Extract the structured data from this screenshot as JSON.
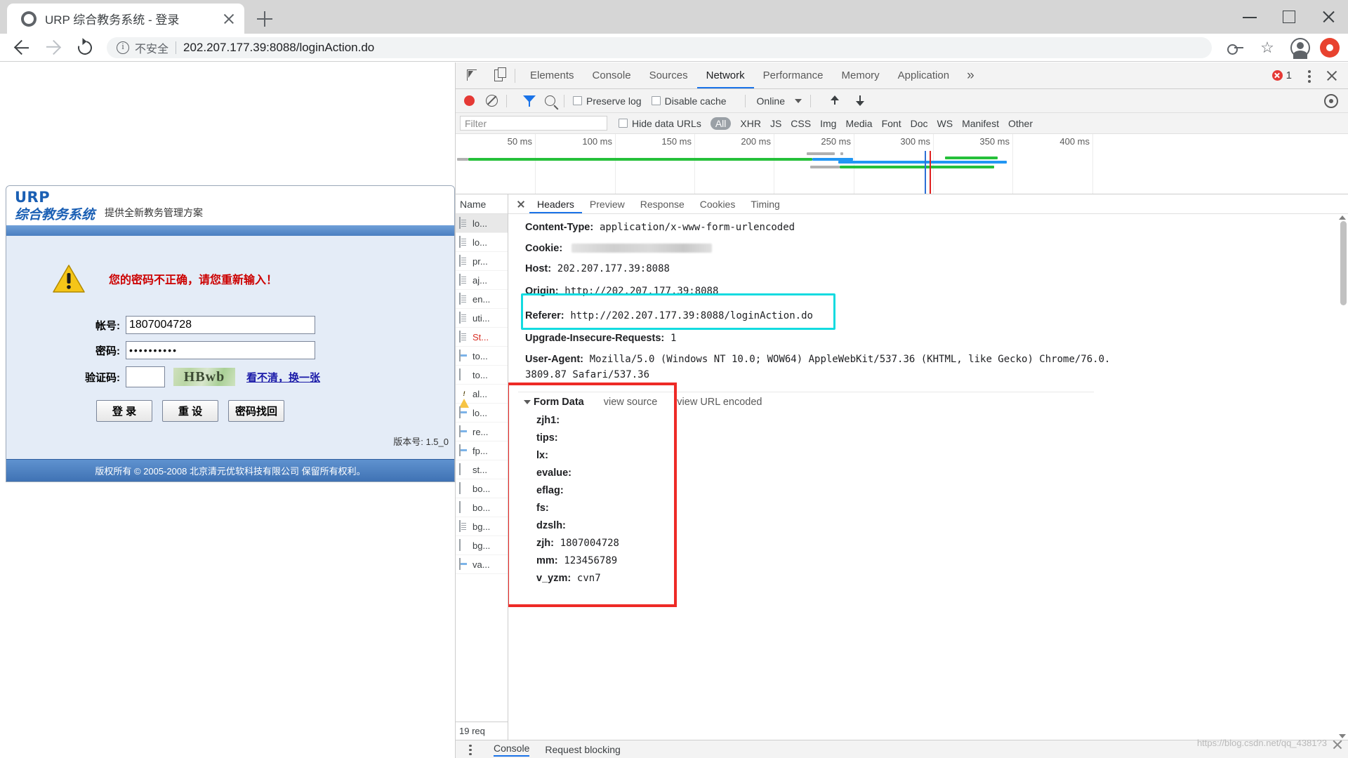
{
  "browser": {
    "tab": {
      "title": "URP 综合教务系统 - 登录",
      "favicon": "globe-icon",
      "close": "×"
    },
    "new_tab": "+",
    "window_controls": {
      "minimize": "−",
      "maximize": "□",
      "close": "×"
    },
    "omnibox": {
      "security_label": "不安全",
      "url": "202.207.177.39:8088/loginAction.do",
      "info_icon": "info-circle-icon"
    },
    "toolbar_right": [
      "key-icon",
      "star-icon",
      "profile-avatar-icon",
      "extension-icon"
    ]
  },
  "page": {
    "logo_line1": "URP",
    "logo_line2": "综合教务系统",
    "slogan": "提供全新教务管理方案",
    "error_message": "您的密码不正确，请您重新输入！",
    "fields": [
      {
        "label": "帐号:",
        "value": "1807004728",
        "placeholder": ""
      },
      {
        "label": "密码:",
        "value": "••••••••••",
        "placeholder": ""
      }
    ],
    "captcha": {
      "label": "验证码:",
      "value": "",
      "placeholder": "",
      "image_text": "HBwb",
      "refresh_link": "看不清，换一张"
    },
    "buttons": [
      {
        "label": "登 录"
      },
      {
        "label": "重 设"
      },
      {
        "label": "密码找回"
      }
    ],
    "version": "版本号: 1.5_0",
    "copyright": "版权所有 © 2005-2008 北京清元优软科技有限公司 保留所有权利。"
  },
  "devtools": {
    "panels": [
      "Elements",
      "Console",
      "Sources",
      "Network",
      "Performance",
      "Memory",
      "Application"
    ],
    "active_panel": "Network",
    "more_panels": "»",
    "error_count": "1",
    "toolbar": {
      "record_title": "record",
      "preserve_log": "Preserve log",
      "disable_cache": "Disable cache",
      "throttle": "Online"
    },
    "filter": {
      "placeholder": "Filter",
      "value": "",
      "hide_data_urls": "Hide data URLs",
      "types": [
        "All",
        "XHR",
        "JS",
        "CSS",
        "Img",
        "Media",
        "Font",
        "Doc",
        "WS",
        "Manifest",
        "Other"
      ],
      "active_type": "All"
    },
    "overview": {
      "ticks": [
        "50 ms",
        "100 ms",
        "150 ms",
        "200 ms",
        "250 ms",
        "300 ms",
        "350 ms",
        "400 ms"
      ]
    },
    "requests": {
      "column_header": "Name",
      "rows": [
        {
          "name": "lo...",
          "icon": "doc-icon",
          "selected": true,
          "error": false
        },
        {
          "name": "lo...",
          "icon": "doc-icon",
          "selected": false,
          "error": false
        },
        {
          "name": "pr...",
          "icon": "doc-icon",
          "selected": false,
          "error": false
        },
        {
          "name": "aj...",
          "icon": "doc-icon",
          "selected": false,
          "error": false
        },
        {
          "name": "en...",
          "icon": "doc-icon",
          "selected": false,
          "error": false
        },
        {
          "name": "uti...",
          "icon": "doc-icon",
          "selected": false,
          "error": false
        },
        {
          "name": "St...",
          "icon": "doc-icon",
          "selected": false,
          "error": true
        },
        {
          "name": "to...",
          "icon": "js-icon",
          "selected": false,
          "error": false
        },
        {
          "name": "to...",
          "icon": "blank-icon",
          "selected": false,
          "error": false
        },
        {
          "name": "al...",
          "icon": "warning-icon",
          "selected": false,
          "error": false
        },
        {
          "name": "lo...",
          "icon": "js-icon",
          "selected": false,
          "error": false
        },
        {
          "name": "re...",
          "icon": "js-icon",
          "selected": false,
          "error": false
        },
        {
          "name": "fp...",
          "icon": "js-icon",
          "selected": false,
          "error": false
        },
        {
          "name": "st...",
          "icon": "blank-icon",
          "selected": false,
          "error": false
        },
        {
          "name": "bo...",
          "icon": "img-icon",
          "selected": false,
          "error": false
        },
        {
          "name": "bo...",
          "icon": "img-icon",
          "selected": false,
          "error": false
        },
        {
          "name": "bg...",
          "icon": "doc-icon",
          "selected": false,
          "error": false
        },
        {
          "name": "bg...",
          "icon": "img-icon",
          "selected": false,
          "error": false
        },
        {
          "name": "va...",
          "icon": "js-icon",
          "selected": false,
          "error": false
        }
      ],
      "footer": "19 req"
    },
    "detail": {
      "tabs": [
        "Headers",
        "Preview",
        "Response",
        "Cookies",
        "Timing"
      ],
      "active_tab": "Headers",
      "headers": [
        {
          "name": "Content-Type:",
          "value": "application/x-www-form-urlencoded",
          "redacted": false
        },
        {
          "name": "Cookie:",
          "value": "",
          "redacted": true
        },
        {
          "name": "Host:",
          "value": "202.207.177.39:8088",
          "redacted": false
        },
        {
          "name": "Origin:",
          "value": "http://202.207.177.39:8088",
          "redacted": false,
          "highlight": "cyan"
        },
        {
          "name": "Referer:",
          "value": "http://202.207.177.39:8088/loginAction.do",
          "redacted": false,
          "highlight": "cyan"
        },
        {
          "name": "Upgrade-Insecure-Requests:",
          "value": "1",
          "redacted": false
        },
        {
          "name": "User-Agent:",
          "value": "Mozilla/5.0 (Windows NT 10.0; WOW64) AppleWebKit/537.36 (KHTML, like Gecko) Chrome/76.0.",
          "redacted": false
        },
        {
          "name": "",
          "value": "3809.87 Safari/537.36",
          "redacted": false
        }
      ],
      "form_data": {
        "title": "Form Data",
        "view_source": "view source",
        "view_url_encoded": "view URL encoded",
        "rows": [
          {
            "key": "zjh1:",
            "value": ""
          },
          {
            "key": "tips:",
            "value": ""
          },
          {
            "key": "lx:",
            "value": ""
          },
          {
            "key": "evalue:",
            "value": ""
          },
          {
            "key": "eflag:",
            "value": ""
          },
          {
            "key": "fs:",
            "value": ""
          },
          {
            "key": "dzslh:",
            "value": ""
          },
          {
            "key": "zjh:",
            "value": "1807004728"
          },
          {
            "key": "mm:",
            "value": "123456789"
          },
          {
            "key": "v_yzm:",
            "value": "cvn7"
          }
        ]
      }
    },
    "drawer": {
      "tabs": [
        "Console",
        "Request blocking"
      ],
      "active": "Console"
    }
  },
  "watermark": "https://blog.csdn.net/qq_4381?3",
  "colors": {
    "accent_blue": "#1a73e8",
    "error_red": "#cc0000",
    "cyan_highlight": "#13dbe0",
    "red_highlight": "#ee2a26",
    "urp_blue": "#1a5fb4"
  }
}
